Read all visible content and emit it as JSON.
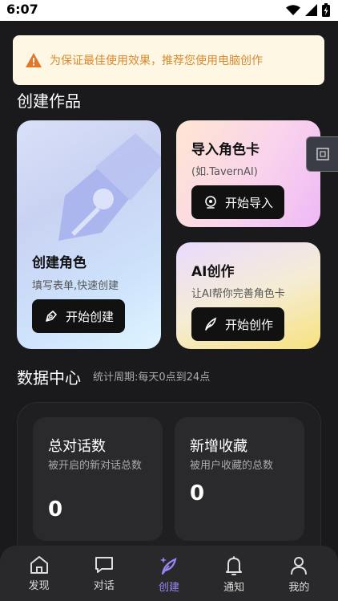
{
  "status_bar": {
    "time": "6:07"
  },
  "toast": {
    "message": "为保证最佳使用效果，推荐您使用电脑创作"
  },
  "create_section": {
    "title": "创建作品",
    "role_card": {
      "title": "创建角色",
      "subtitle": "填写表单,快速创建",
      "button": "开始创建"
    },
    "import_card": {
      "title": "导入角色卡",
      "subtitle": "(如.TavernAI)",
      "button": "开始导入"
    },
    "ai_card": {
      "title": "AI创作",
      "subtitle": "让AI帮你完善角色卡",
      "button": "开始创作"
    }
  },
  "data_center": {
    "title": "数据中心",
    "period": "统计周期:每天0点到24点",
    "stats": [
      {
        "title": "总对话数",
        "desc": "被开启的新对话总数",
        "value": "0"
      },
      {
        "title": "新增收藏",
        "desc": "被用户收藏的总数",
        "value": "0"
      }
    ]
  },
  "tab_bar": {
    "tabs": [
      {
        "label": "发现",
        "icon": "home-icon"
      },
      {
        "label": "对话",
        "icon": "chat-icon"
      },
      {
        "label": "创建",
        "icon": "feather-icon",
        "active": true
      },
      {
        "label": "通知",
        "icon": "bell-icon"
      },
      {
        "label": "我的",
        "icon": "person-icon"
      }
    ]
  },
  "colors": {
    "accent": "#9b86f5",
    "warning": "#d9892e",
    "background": "#1a1a1c"
  }
}
